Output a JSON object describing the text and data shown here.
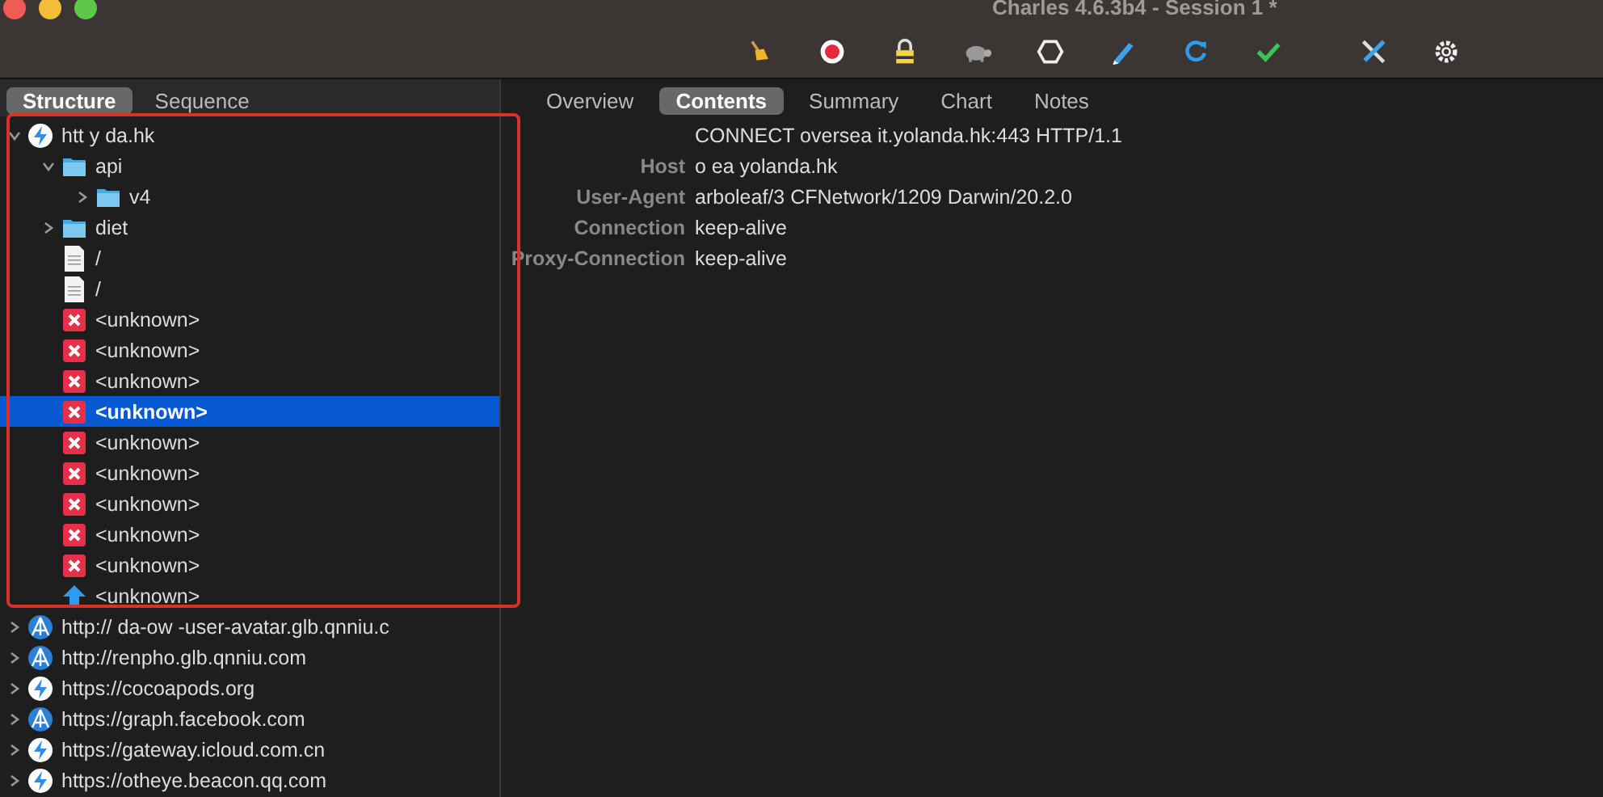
{
  "window": {
    "title": "Charles 4.6.3b4 - Session 1 *"
  },
  "toolbar": [
    {
      "kind": "broom"
    },
    {
      "kind": "record"
    },
    {
      "kind": "lock"
    },
    {
      "kind": "turtle"
    },
    {
      "kind": "hexagon"
    },
    {
      "kind": "pen"
    },
    {
      "kind": "refresh"
    },
    {
      "kind": "check"
    },
    {
      "kind": "tools"
    },
    {
      "kind": "gear"
    }
  ],
  "left_tabs": [
    {
      "label": "Structure",
      "selected": true
    },
    {
      "label": "Sequence",
      "selected": false
    }
  ],
  "tree": [
    {
      "label": "htt   y   da.hk",
      "kind": "bolt",
      "expanded": true,
      "selected": false,
      "children": [
        {
          "label": "api",
          "kind": "folder",
          "expanded": true,
          "selected": false,
          "children": [
            {
              "label": "v4",
              "kind": "folder",
              "expanded": false,
              "selected": false
            }
          ]
        },
        {
          "label": "   diet",
          "kind": "folder",
          "expanded": false,
          "selected": false
        },
        {
          "label": "/",
          "kind": "file",
          "selected": false
        },
        {
          "label": "/",
          "kind": "file",
          "selected": false
        },
        {
          "label": "<unknown>",
          "kind": "error",
          "selected": false
        },
        {
          "label": "<unknown>",
          "kind": "error",
          "selected": false
        },
        {
          "label": "<unknown>",
          "kind": "error",
          "selected": false
        },
        {
          "label": "<unknown>",
          "kind": "error",
          "selected": true
        },
        {
          "label": "<unknown>",
          "kind": "error",
          "selected": false
        },
        {
          "label": "<unknown>",
          "kind": "error",
          "selected": false
        },
        {
          "label": "<unknown>",
          "kind": "error",
          "selected": false
        },
        {
          "label": "<unknown>",
          "kind": "error",
          "selected": false
        },
        {
          "label": "<unknown>",
          "kind": "error",
          "selected": false
        },
        {
          "label": "<unknown>",
          "kind": "upload",
          "selected": false
        }
      ]
    },
    {
      "label": "http://     da-ow      -user-avatar.glb.qnniu.c",
      "kind": "globe",
      "expanded": false,
      "selected": false
    },
    {
      "label": "http://renpho.glb.qnniu.com",
      "kind": "globe",
      "expanded": false,
      "selected": false
    },
    {
      "label": "https://cocoapods.org",
      "kind": "bolt",
      "expanded": false,
      "selected": false
    },
    {
      "label": "https://graph.facebook.com",
      "kind": "globe",
      "expanded": false,
      "selected": false
    },
    {
      "label": "https://gateway.icloud.com.cn",
      "kind": "bolt",
      "expanded": false,
      "selected": false
    },
    {
      "label": "https://otheye.beacon.qq.com",
      "kind": "bolt",
      "expanded": false,
      "selected": false
    }
  ],
  "right_tabs": [
    {
      "label": "Overview",
      "selected": false
    },
    {
      "label": "Contents",
      "selected": true
    },
    {
      "label": "Summary",
      "selected": false
    },
    {
      "label": "Chart",
      "selected": false
    },
    {
      "label": "Notes",
      "selected": false
    }
  ],
  "headers": [
    {
      "value": "CONNECT overseа   it.yolanda.hk:443 HTTP/1.1"
    },
    {
      "name": "Host",
      "value": "o     ea     yolanda.hk"
    },
    {
      "name": "User-Agent",
      "value": "arboleaf/3 CFNetwork/1209 Darwin/20.2.0"
    },
    {
      "name": "Connection",
      "value": "keep-alive"
    },
    {
      "name": "Proxy-Connection",
      "value": "keep-alive"
    }
  ]
}
